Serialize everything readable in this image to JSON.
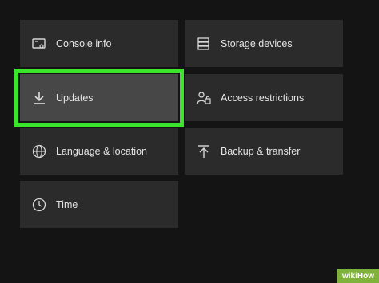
{
  "settings_tiles": {
    "console_info": {
      "label": "Console info",
      "icon": "console-icon"
    },
    "storage_devices": {
      "label": "Storage devices",
      "icon": "storage-icon"
    },
    "updates": {
      "label": "Updates",
      "icon": "download-icon",
      "selected": true
    },
    "access_restrictions": {
      "label": "Access restrictions",
      "icon": "people-lock-icon"
    },
    "language_location": {
      "label": "Language & location",
      "icon": "globe-icon"
    },
    "backup_transfer": {
      "label": "Backup & transfer",
      "icon": "upload-icon"
    },
    "time": {
      "label": "Time",
      "icon": "clock-icon"
    }
  },
  "watermark": {
    "part1": "wiki",
    "part2": "How"
  },
  "colors": {
    "highlight": "#3be52b",
    "tile": "#2b2b2b",
    "tile_selected": "#474747",
    "background": "#141414"
  }
}
